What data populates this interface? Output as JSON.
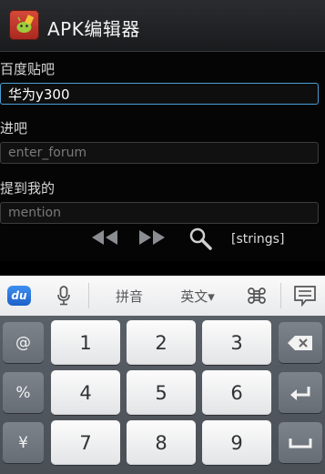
{
  "app": {
    "title": "APK编辑器"
  },
  "fields": [
    {
      "label": "百度贴吧",
      "value": "华为y300",
      "placeholder": ""
    },
    {
      "label": "进吧",
      "value": "",
      "placeholder": "enter_forum"
    },
    {
      "label": "提到我的",
      "value": "",
      "placeholder": "mention"
    }
  ],
  "actions": {
    "strings_label": "[strings]",
    "icons": [
      "rewind-icon",
      "fast-forward-icon",
      "search-icon"
    ]
  },
  "keyboard": {
    "logo": "du",
    "toolbar": {
      "pinyin": "拼音",
      "english": "英文▾"
    },
    "left_keys": [
      "@",
      "%",
      "¥"
    ],
    "num_keys": [
      "1",
      "2",
      "3",
      "4",
      "5",
      "6",
      "7",
      "8",
      "9"
    ]
  },
  "colors": {
    "accent": "#4a9fd4",
    "icon_red": "#c0392b",
    "key_face": "#f5f5f5",
    "keyboard_bg": "#50565d"
  }
}
